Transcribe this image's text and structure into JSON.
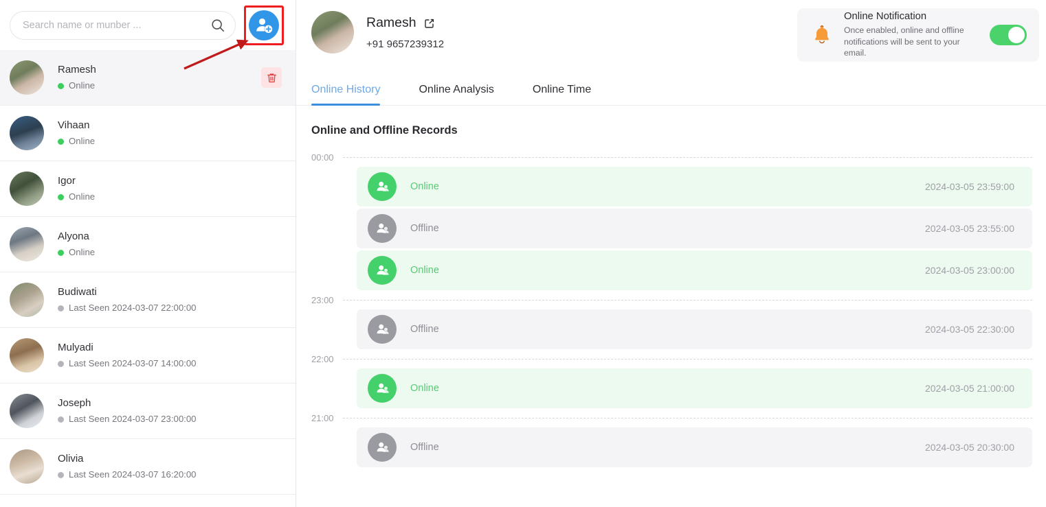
{
  "sidebar": {
    "search": {
      "placeholder": "Search name or munber ...",
      "value": "",
      "icon": "search-icon"
    },
    "add_contact_button": {
      "icon": "add-user-icon",
      "highlighted": true,
      "highlight_color": "#ee1c1c",
      "button_color": "#3296e8"
    },
    "contacts": [
      {
        "name": "Ramesh",
        "status": "Online",
        "state": "online",
        "selected": true,
        "has_delete": true
      },
      {
        "name": "Vihaan",
        "status": "Online",
        "state": "online",
        "selected": false,
        "has_delete": false
      },
      {
        "name": "Igor",
        "status": "Online",
        "state": "online",
        "selected": false,
        "has_delete": false
      },
      {
        "name": "Alyona",
        "status": "Online",
        "state": "online",
        "selected": false,
        "has_delete": false
      },
      {
        "name": "Budiwati",
        "status": "Last Seen 2024-03-07 22:00:00",
        "state": "offline",
        "selected": false,
        "has_delete": false
      },
      {
        "name": "Mulyadi",
        "status": "Last Seen 2024-03-07 14:00:00",
        "state": "offline",
        "selected": false,
        "has_delete": false
      },
      {
        "name": "Joseph",
        "status": "Last Seen 2024-03-07 23:00:00",
        "state": "offline",
        "selected": false,
        "has_delete": false
      },
      {
        "name": "Olivia",
        "status": "Last Seen 2024-03-07 16:20:00",
        "state": "offline",
        "selected": false,
        "has_delete": false
      }
    ]
  },
  "profile": {
    "name": "Ramesh",
    "phone": "+91 9657239312",
    "edit_icon": "edit-icon"
  },
  "tabs": [
    {
      "label": "Online History",
      "active": true
    },
    {
      "label": "Online Analysis",
      "active": false
    },
    {
      "label": "Online Time",
      "active": false
    }
  ],
  "records_section": {
    "title": "Online and Offline Records"
  },
  "notification": {
    "icon": "bell-icon",
    "title": "Online Notification",
    "subtitle": "Once enabled, online and offline notifications will be sent to your email.",
    "toggle_on": true,
    "toggle_color": "#4cd26a"
  },
  "timeline": {
    "entries": [
      {
        "kind": "axis",
        "label": "00:00"
      },
      {
        "kind": "record",
        "status": "Online",
        "state": "online",
        "time": "2024-03-05 23:59:00"
      },
      {
        "kind": "record",
        "status": "Offline",
        "state": "offline",
        "time": "2024-03-05 23:55:00"
      },
      {
        "kind": "record",
        "status": "Online",
        "state": "online",
        "time": "2024-03-05 23:00:00"
      },
      {
        "kind": "axis",
        "label": "23:00"
      },
      {
        "kind": "record",
        "status": "Offline",
        "state": "offline",
        "time": "2024-03-05 22:30:00"
      },
      {
        "kind": "axis",
        "label": "22:00"
      },
      {
        "kind": "record",
        "status": "Online",
        "state": "online",
        "time": "2024-03-05 21:00:00"
      },
      {
        "kind": "axis",
        "label": "21:00"
      },
      {
        "kind": "record",
        "status": "Offline",
        "state": "offline",
        "time": "2024-03-05 20:30:00"
      }
    ]
  },
  "colors": {
    "online_green": "#44d06a",
    "online_text": "#5cc878",
    "offline_gray": "#9a9ba1",
    "accent_blue": "#3b8ddd",
    "active_tab_text": "#6fa9e3",
    "annotation_red": "#c01a1a"
  }
}
